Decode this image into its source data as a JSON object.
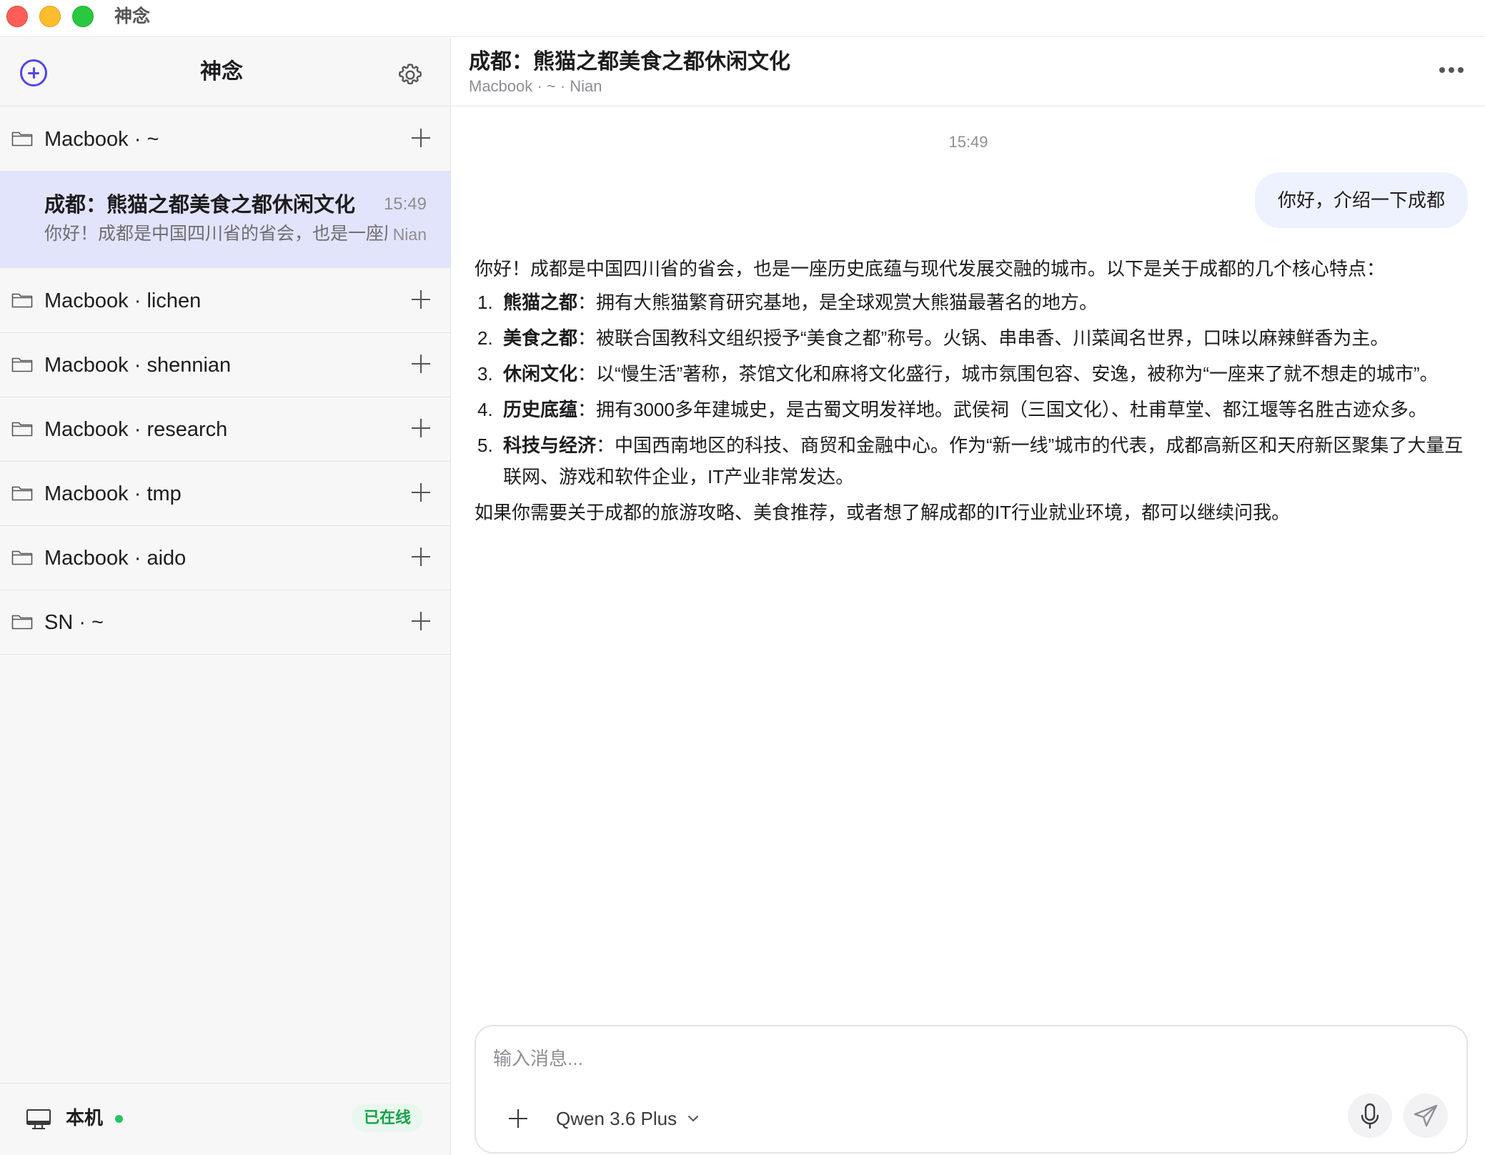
{
  "window": {
    "title": "神念"
  },
  "sidebar": {
    "app_name": "神念",
    "groups": [
      {
        "label": "Macbook · ~"
      },
      {
        "label": "Macbook · lichen"
      },
      {
        "label": "Macbook · shennian"
      },
      {
        "label": "Macbook · research"
      },
      {
        "label": "Macbook · tmp"
      },
      {
        "label": "Macbook · aido"
      },
      {
        "label": "SN · ~"
      }
    ],
    "active_session": {
      "title": "成都：熊猫之都美食之都休闲文化",
      "time": "15:49",
      "preview": "你好！成都是中国四川省的省会，也是一座历史底蕴与现代发展交融的城市。以下是关于成都的几个核心特点",
      "user": "Nian"
    },
    "footer": {
      "machine": "本机",
      "status": "已在线",
      "status_color": "#22c55e"
    }
  },
  "chat": {
    "title": "成都：熊猫之都美食之都休闲文化",
    "subtitle": "Macbook · ~ · Nian",
    "timestamp": "15:49",
    "user_message": "你好，介绍一下成都",
    "answer": {
      "intro": "你好！成都是中国四川省的省会，也是一座历史底蕴与现代发展交融的城市。以下是关于成都的几个核心特点：",
      "items": [
        {
          "num": "1.",
          "title": "熊猫之都",
          "text": "：拥有大熊猫繁育研究基地，是全球观赏大熊猫最著名的地方。"
        },
        {
          "num": "2.",
          "title": "美食之都",
          "text": "：被联合国教科文组织授予“美食之都”称号。火锅、串串香、川菜闻名世界，口味以麻辣鲜香为主。"
        },
        {
          "num": "3.",
          "title": "休闲文化",
          "text": "：以“慢生活”著称，茶馆文化和麻将文化盛行，城市氛围包容、安逸，被称为“一座来了就不想走的城市”。"
        },
        {
          "num": "4.",
          "title": "历史底蕴",
          "text": "：拥有3000多年建城史，是古蜀文明发祥地。武侯祠（三国文化）、杜甫草堂、都江堰等名胜古迹众多。"
        },
        {
          "num": "5.",
          "title": "科技与经济",
          "text": "：中国西南地区的科技、商贸和金融中心。作为“新一线”城市的代表，成都高新区和天府新区聚集了大量互联网、游戏和软件企业，IT产业非常发达。"
        }
      ],
      "outro": "如果你需要关于成都的旅游攻略、美食推荐，或者想了解成都的IT行业就业环境，都可以继续问我。"
    }
  },
  "composer": {
    "placeholder": "输入消息...",
    "value": "",
    "model": "Qwen 3.6 Plus"
  },
  "theme": {
    "accent": "#4f46e5",
    "active_row": "#e2e4fb",
    "user_bubble": "#eef2fe"
  },
  "icons": {
    "new_chat": "plus-circle-icon",
    "settings": "gear-icon",
    "folder": "folder-icon",
    "add": "plus-icon",
    "more": "ellipsis-icon",
    "machine": "monitor-icon",
    "mic": "microphone-icon",
    "send": "paper-plane-icon",
    "model_dropdown": "chevron-down-icon"
  }
}
